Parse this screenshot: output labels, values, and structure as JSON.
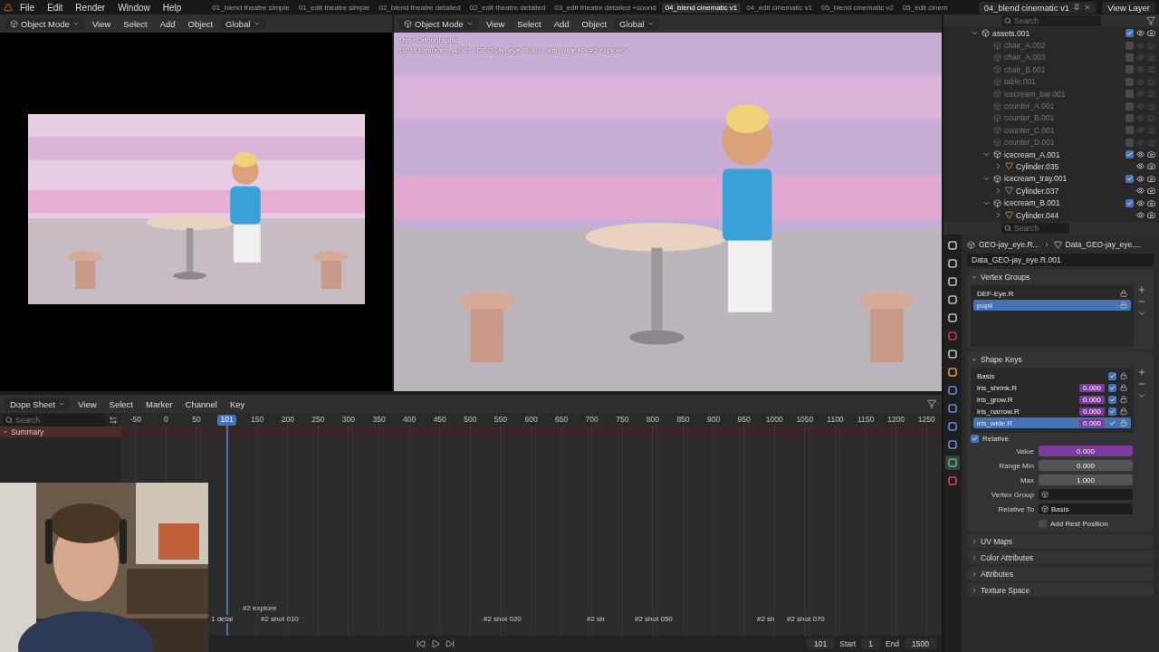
{
  "menu": [
    "File",
    "Edit",
    "Render",
    "Window",
    "Help"
  ],
  "workspaces": [
    {
      "label": "01_blend theatre simple",
      "selected": false
    },
    {
      "label": "01_edit theatre simple",
      "selected": false
    },
    {
      "label": "02_blend theatre detailed",
      "selected": false
    },
    {
      "label": "02_edit theatre detailed",
      "selected": false
    },
    {
      "label": "03_edit theatre detailed +sound",
      "selected": false
    },
    {
      "label": "04_blend cinematic v1",
      "selected": true
    },
    {
      "label": "04_edit cinematic v1",
      "selected": false
    },
    {
      "label": "05_blend cinematic v2",
      "selected": false
    },
    {
      "label": "05_edit cinem",
      "selected": false
    }
  ],
  "scene": "04_blend cinematic v1",
  "view_layer": "View Layer",
  "left_view": {
    "mode": "Object Mode",
    "menus": [
      "View",
      "Select",
      "Add",
      "Object"
    ],
    "orientation": "Global"
  },
  "main_view": {
    "mode": "Object Mode",
    "menus": [
      "View",
      "Select",
      "Add",
      "Object"
    ],
    "orientation": "Global",
    "overlay": [
      "User Orthographic",
      "(101) Icecream_A.001 | GEO-jay_eye.R.001 : iris_wide.R <#2 explore>"
    ]
  },
  "outliner": {
    "search": {
      "placeholder": "Search"
    },
    "items": [
      {
        "kind": "collection",
        "label": "assets.001",
        "expanded": true,
        "checked": true,
        "children": [
          {
            "kind": "collection",
            "label": "chair_A.002",
            "checked": false
          },
          {
            "kind": "collection",
            "label": "chair_A.003",
            "checked": false
          },
          {
            "kind": "collection",
            "label": "chair_B.001",
            "checked": false
          },
          {
            "kind": "collection",
            "label": "table.001",
            "checked": false
          },
          {
            "kind": "collection",
            "label": "icecream_bar.001",
            "checked": false
          },
          {
            "kind": "collection",
            "label": "counter_A.001",
            "checked": false
          },
          {
            "kind": "collection",
            "label": "counter_B.001",
            "checked": false
          },
          {
            "kind": "collection",
            "label": "counter_C.001",
            "checked": false
          },
          {
            "kind": "collection",
            "label": "counter_D.001",
            "checked": false
          },
          {
            "kind": "collection",
            "label": "icecream_A.001",
            "expanded": true,
            "checked": true,
            "children": [
              {
                "kind": "object",
                "label": "Cylinder.035",
                "expanded": false
              }
            ]
          },
          {
            "kind": "collection",
            "label": "icecream_tray.001",
            "expanded": true,
            "checked": true,
            "children": [
              {
                "kind": "object",
                "label": "Cylinder.037",
                "expanded": false
              }
            ]
          },
          {
            "kind": "collection",
            "label": "icecream_B.001",
            "expanded": true,
            "checked": true,
            "children": [
              {
                "kind": "object",
                "label": "Cylinder.044",
                "expanded": false
              }
            ]
          }
        ]
      }
    ]
  },
  "properties": {
    "search": {
      "placeholder": "Search"
    },
    "tabs": [
      {
        "kind": "tool",
        "selected": false
      },
      {
        "kind": "render",
        "selected": false
      },
      {
        "kind": "output",
        "selected": false
      },
      {
        "kind": "view_layer",
        "selected": false
      },
      {
        "kind": "scene",
        "selected": false
      },
      {
        "kind": "world",
        "selected": false
      },
      {
        "kind": "collection",
        "selected": false
      },
      {
        "kind": "object",
        "selected": false
      },
      {
        "kind": "modifiers",
        "selected": false
      },
      {
        "kind": "particles",
        "selected": false
      },
      {
        "kind": "physics",
        "selected": false
      },
      {
        "kind": "constraints",
        "selected": false
      },
      {
        "kind": "data",
        "selected": true
      },
      {
        "kind": "material",
        "selected": false
      }
    ],
    "breadcrumb": [
      "GEO-jay_eye.R...",
      "Data_GEO-jay_eye...."
    ],
    "data_name": "Data_GEO-jay_eye.R.001",
    "vertex_groups": {
      "title": "Vertex Groups",
      "expanded": true,
      "items": [
        {
          "name": "DEF-Eye.R",
          "selected": false
        },
        {
          "name": "pupil",
          "selected": true
        }
      ]
    },
    "shape_keys": {
      "title": "Shape Keys",
      "expanded": true,
      "items": [
        {
          "name": "Basis",
          "enabled": true,
          "selected": false
        },
        {
          "name": "iris_shrink.R",
          "value": "0.000",
          "enabled": true,
          "selected": false
        },
        {
          "name": "iris_grow.R",
          "value": "0.000",
          "enabled": true,
          "selected": false
        },
        {
          "name": "iris_narrow.R",
          "value": "0.000",
          "enabled": true,
          "selected": false
        },
        {
          "name": "iris_wide.R",
          "value": "0.000",
          "enabled": true,
          "selected": true
        }
      ],
      "relative": {
        "label": "Relative",
        "checked": true
      },
      "fields": [
        {
          "kind": "number",
          "label": "Value",
          "value": "0.000",
          "keyed": true
        },
        {
          "kind": "number",
          "label": "Range Min",
          "value": "0.000",
          "keyed": false
        },
        {
          "kind": "number",
          "label": "Max",
          "value": "1.000",
          "keyed": false
        },
        {
          "kind": "search",
          "label": "Vertex Group"
        },
        {
          "kind": "search",
          "label": "Relative To",
          "value": "Basis"
        },
        {
          "kind": "checkbox",
          "label": "Add Rest Position",
          "checked": false
        }
      ]
    },
    "collapsed_panels": [
      {
        "title": "UV Maps",
        "expanded": false
      },
      {
        "title": "Color Attributes",
        "expanded": false
      },
      {
        "title": "Attributes",
        "expanded": false
      },
      {
        "title": "Texture Space",
        "expanded": false
      }
    ]
  },
  "dope_sheet": {
    "mode": "Dope Sheet",
    "menus": [
      "View",
      "Select",
      "Marker",
      "Channel",
      "Key"
    ],
    "search": {
      "placeholder": "Search"
    },
    "frames": [
      {
        "label": "-50",
        "selected": false
      },
      {
        "label": "0",
        "selected": false
      },
      {
        "label": "50",
        "selected": false
      },
      {
        "label": "101",
        "selected": true
      },
      {
        "label": "150",
        "selected": false
      },
      {
        "label": "200",
        "selected": false
      },
      {
        "label": "250",
        "selected": false
      },
      {
        "label": "300",
        "selected": false
      },
      {
        "label": "350",
        "selected": false
      },
      {
        "label": "400",
        "selected": false
      },
      {
        "label": "450",
        "selected": false
      },
      {
        "label": "500",
        "selected": false
      },
      {
        "label": "550",
        "selected": false
      },
      {
        "label": "600",
        "selected": false
      },
      {
        "label": "650",
        "selected": false
      },
      {
        "label": "700",
        "selected": false
      },
      {
        "label": "750",
        "selected": false
      },
      {
        "label": "800",
        "selected": false
      },
      {
        "label": "850",
        "selected": false
      },
      {
        "label": "900",
        "selected": false
      },
      {
        "label": "950",
        "selected": false
      },
      {
        "label": "1000",
        "selected": false
      },
      {
        "label": "1050",
        "selected": false
      },
      {
        "label": "1100",
        "selected": false
      },
      {
        "label": "1150",
        "selected": false
      },
      {
        "label": "1200",
        "selected": false
      },
      {
        "label": "1250",
        "selected": false
      }
    ],
    "channels": [
      {
        "label": "Summary",
        "expanded": true
      }
    ],
    "markers": [
      "#2 explore",
      "1 detai",
      "#2 shot 010",
      "#2 shot 020",
      "#2 sh",
      "#2 shot 050",
      "#2 sh",
      "#2 shot 070"
    ]
  },
  "playback": {
    "frame": "101",
    "start_label": "Start",
    "start": "1",
    "end_label": "End",
    "end": "1500"
  }
}
